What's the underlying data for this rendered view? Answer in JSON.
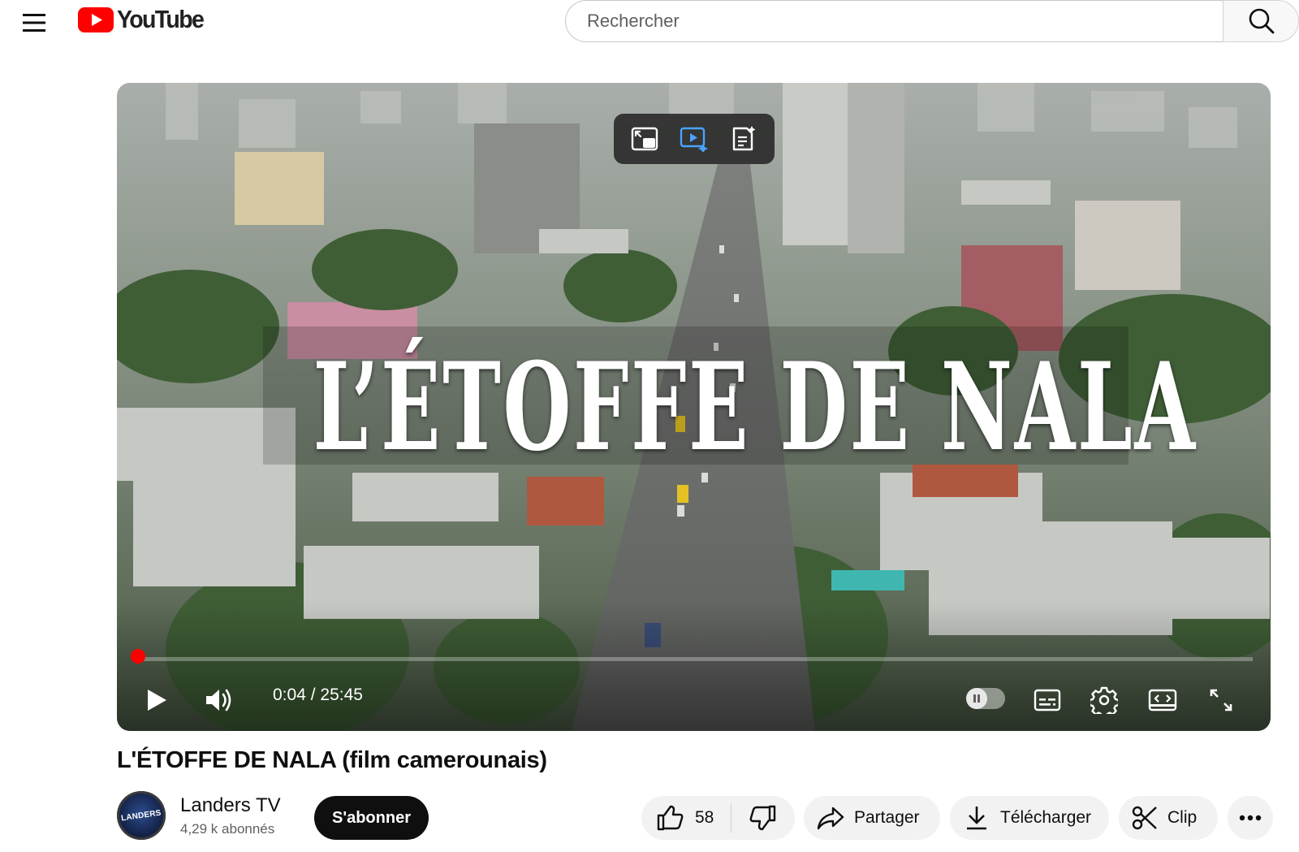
{
  "header": {
    "logo_text": "YouTube",
    "search": {
      "placeholder": "Rechercher",
      "value": ""
    }
  },
  "player": {
    "title_card": "L’ÉTOFFE DE NALA",
    "time_current": "0:04",
    "time_total": "25:45",
    "time_display": "0:04 / 25:45",
    "progress_fraction": 0.0026,
    "accent_color": "#ff0000"
  },
  "video": {
    "title": "L'ÉTOFFE DE NALA (film camerounais)",
    "channel": {
      "name": "Landers TV",
      "subscribers": "4,29 k abonnés",
      "avatar_text": "LANDERS"
    },
    "actions": {
      "subscribe": "S'abonner",
      "likes": "58",
      "share": "Partager",
      "download": "Télécharger",
      "clip": "Clip"
    }
  }
}
